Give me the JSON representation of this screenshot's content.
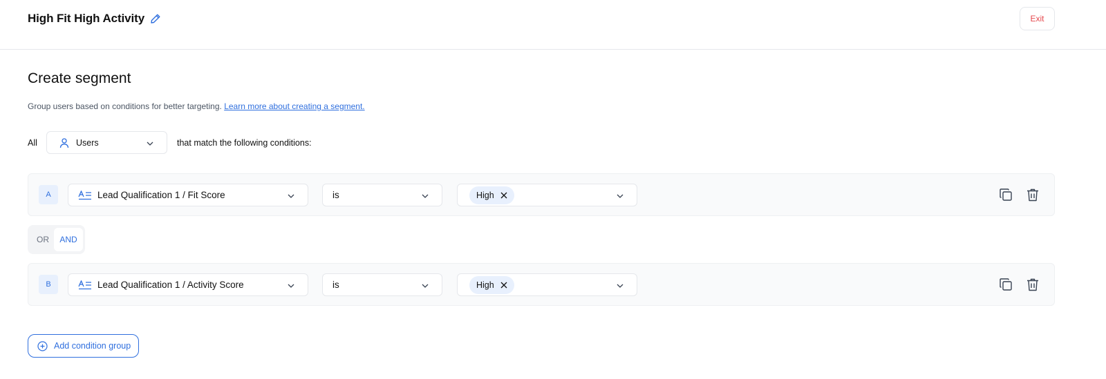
{
  "header": {
    "title": "High Fit High Activity",
    "exit_label": "Exit"
  },
  "page": {
    "title": "Create segment",
    "description": "Group users based on conditions for better targeting.",
    "learn_more": "Learn more about creating a segment."
  },
  "match": {
    "prefix": "All",
    "entity": "Users",
    "suffix": "that match the following conditions:"
  },
  "conditions": [
    {
      "letter": "A",
      "field": "Lead Qualification 1 / Fit Score",
      "operator": "is",
      "values": [
        "High"
      ]
    },
    {
      "letter": "B",
      "field": "Lead Qualification 1 / Activity Score",
      "operator": "is",
      "values": [
        "High"
      ]
    }
  ],
  "logic": {
    "options": [
      "OR",
      "AND"
    ],
    "selected": "AND"
  },
  "add_group_label": "Add condition group",
  "colors": {
    "accent": "#2f6fde",
    "danger": "#e5484d",
    "tag_bg": "#e8f0fd",
    "row_bg": "#f9fafb"
  },
  "icons": {
    "edit": "pencil-icon",
    "entity": "user-icon",
    "field": "text-attribute-icon",
    "tag_remove": "close-icon",
    "copy": "copy-icon",
    "delete": "trash-icon",
    "add": "plus-circle-icon",
    "dropdown": "chevron-down-icon"
  }
}
